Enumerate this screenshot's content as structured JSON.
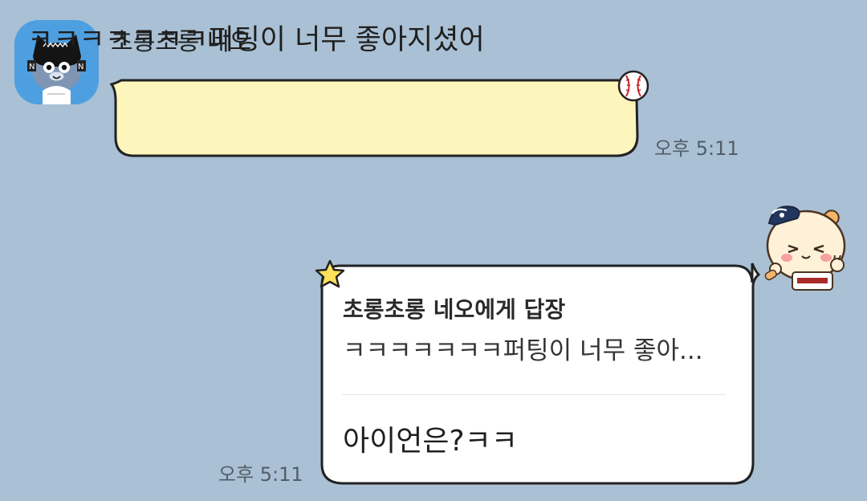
{
  "incoming": {
    "sender_name": "초롱초롱 네오",
    "message": "ㅋㅋㅋㅋㅋㅋㅋ퍼팅이 너무 좋아지셨어",
    "time": "오후 5:11",
    "avatar_icon": "neo-character-icon"
  },
  "outgoing": {
    "reply_title": "초롱초롱 네오에게 답장",
    "reply_quote": "ㅋㅋㅋㅋㅋㅋㅋ퍼팅이 너무 좋아...",
    "message": "아이언은?ㅋㅋ",
    "time": "오후 5:11"
  },
  "stickers": {
    "incoming": "baseball-icon",
    "outgoing_star": "star-icon",
    "outgoing_character": "baseball-character-icon"
  },
  "colors": {
    "background": "#aac0d4",
    "incoming_bubble": "#fcf6bd",
    "outgoing_bubble": "#ffffff",
    "avatar_bg": "#4d9fe0",
    "star": "#ffe15a"
  }
}
